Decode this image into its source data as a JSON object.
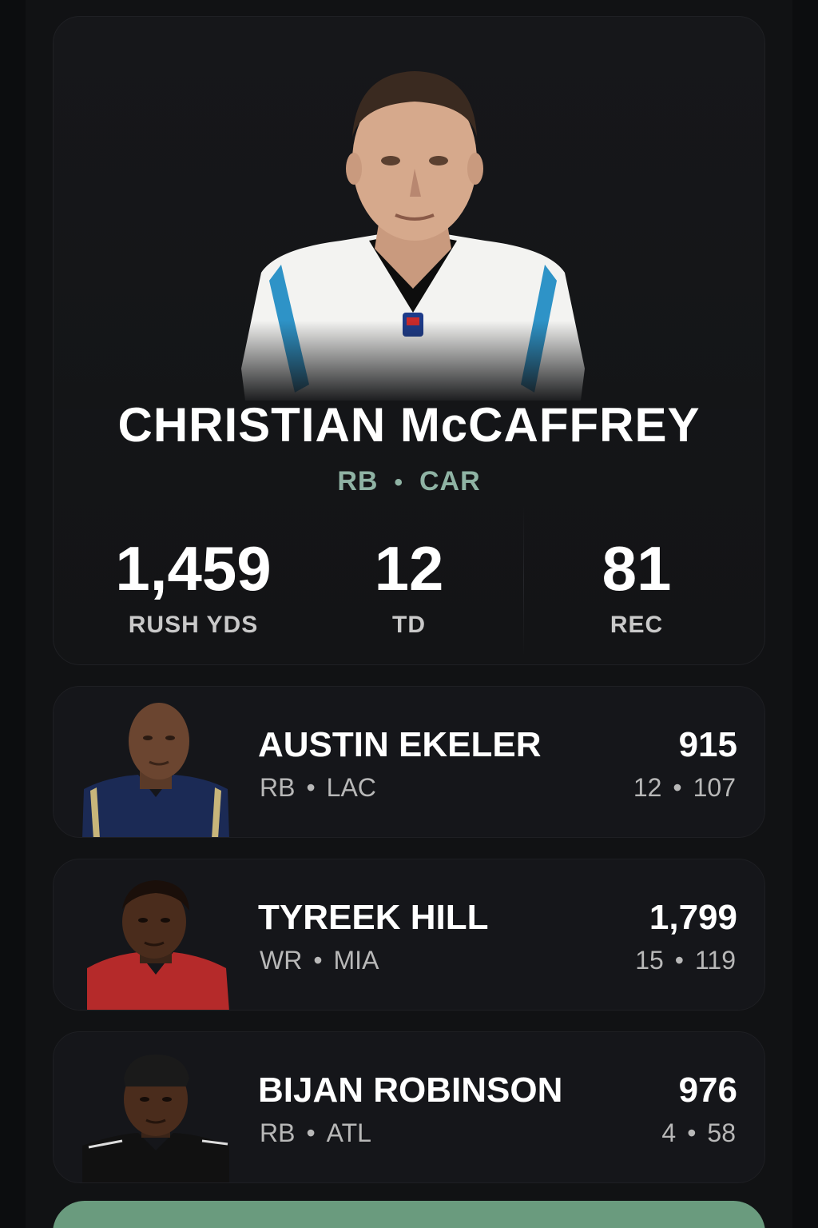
{
  "featured": {
    "name": "CHRISTIAN McCAFFREY",
    "position": "RB",
    "team": "CAR",
    "stats": [
      {
        "value": "1,459",
        "label": "RUSH YDS"
      },
      {
        "value": "12",
        "label": "TD"
      },
      {
        "value": "81",
        "label": "REC"
      }
    ],
    "jersey_colors": {
      "primary": "#f3f3f1",
      "accent": "#2e93c7",
      "trim": "#0d0d0d"
    }
  },
  "players": [
    {
      "name": "AUSTIN EKELER",
      "position": "RB",
      "team": "LAC",
      "main_stat": "915",
      "sub_stat_a": "12",
      "sub_stat_b": "107",
      "jersey": "#1b2a55"
    },
    {
      "name": "TYREEK HILL",
      "position": "WR",
      "team": "MIA",
      "main_stat": "1,799",
      "sub_stat_a": "15",
      "sub_stat_b": "119",
      "jersey": "#b52a2a"
    },
    {
      "name": "BIJAN ROBINSON",
      "position": "RB",
      "team": "ATL",
      "main_stat": "976",
      "sub_stat_a": "4",
      "sub_stat_b": "58",
      "jersey": "#111111"
    }
  ],
  "separator": "•",
  "accent_color": "#8fb3a4",
  "cta_color": "#6a9b7e"
}
